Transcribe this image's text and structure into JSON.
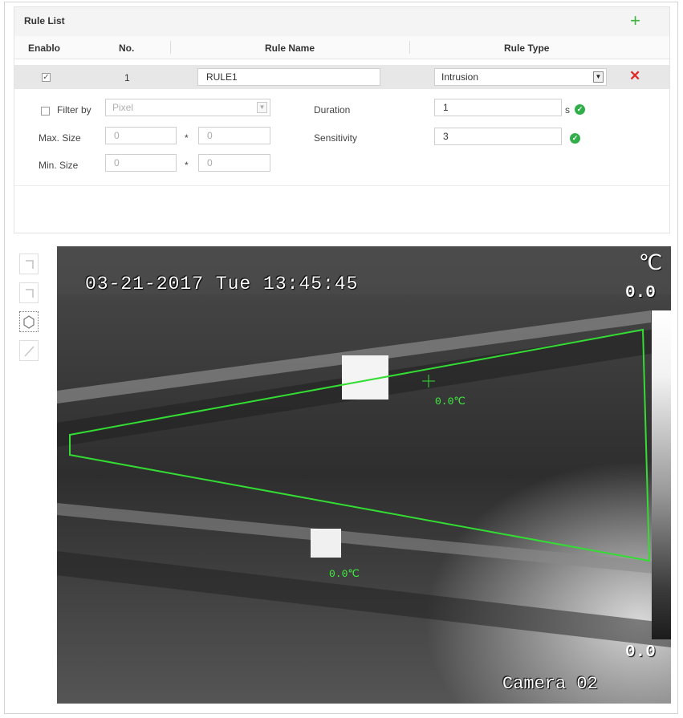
{
  "rule_list": {
    "title": "Rule List",
    "add_icon": "plus-icon",
    "columns": [
      "Enablo",
      "No.",
      "Rule Name",
      "Rule Type"
    ],
    "rows": [
      {
        "enabled": true,
        "no": "1",
        "name": "RULE1",
        "type": "Intrusion",
        "delete_icon": "close-icon"
      }
    ],
    "settings": {
      "filter_label": "Filter by",
      "filter_checked": false,
      "filter_value": "Pixel",
      "max_size_label": "Max. Size",
      "max_w": "0",
      "max_h": "0",
      "min_size_label": "Min. Size",
      "min_w": "0",
      "min_h": "0",
      "times": "*",
      "duration_label": "Duration",
      "duration_value": "1",
      "duration_unit": "s",
      "sensitivity_label": "Sensitivity",
      "sensitivity_value": "3",
      "ok_icon": "checkmark-circle-icon"
    }
  },
  "toolbar": {
    "tools": [
      "draw-rect-icon",
      "draw-rect-alt-icon",
      "draw-polygon-icon",
      "draw-line-icon"
    ],
    "active_tool": "draw-polygon-icon"
  },
  "video": {
    "timestamp": "03-21-2017 Tue 13:45:45",
    "camera_label": "Camera 02",
    "temp_unit": "℃",
    "scale_max": "0.0",
    "scale_min": "0.0",
    "temp_marker_1": "0.0℃",
    "temp_marker_2": "0.0℃",
    "region_color": "#33dd33"
  }
}
